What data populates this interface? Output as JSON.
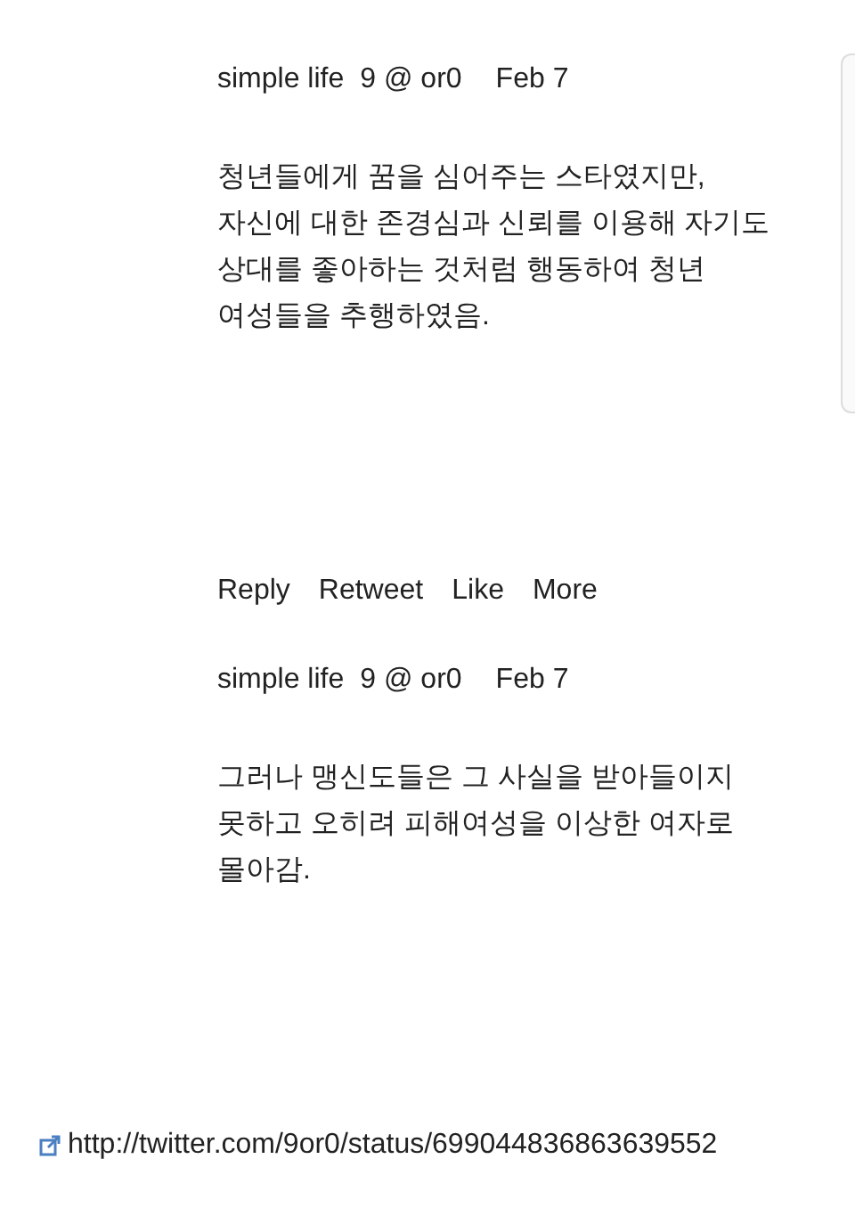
{
  "tweets": [
    {
      "author": "simple life",
      "handle": "9 @ or0",
      "date": "Feb 7",
      "text": "청년들에게 꿈을 심어주는 스타였지만, 자신에 대한 존경심과 신뢰를 이용해 자기도 상대를 좋아하는 것처럼 행동하여 청년 여성들을 추행하였음.",
      "actions": [
        "Reply",
        "Retweet",
        "Like",
        "More"
      ]
    },
    {
      "author": "simple life",
      "handle": "9 @ or0",
      "date": "Feb 7",
      "text": "그러나 맹신도들은 그 사실을 받아들이지 못하고 오히려 피해여성을 이상한 여자로 몰아감."
    }
  ],
  "link": {
    "url": "http://twitter.com/9or0/status/699044836863639552"
  }
}
